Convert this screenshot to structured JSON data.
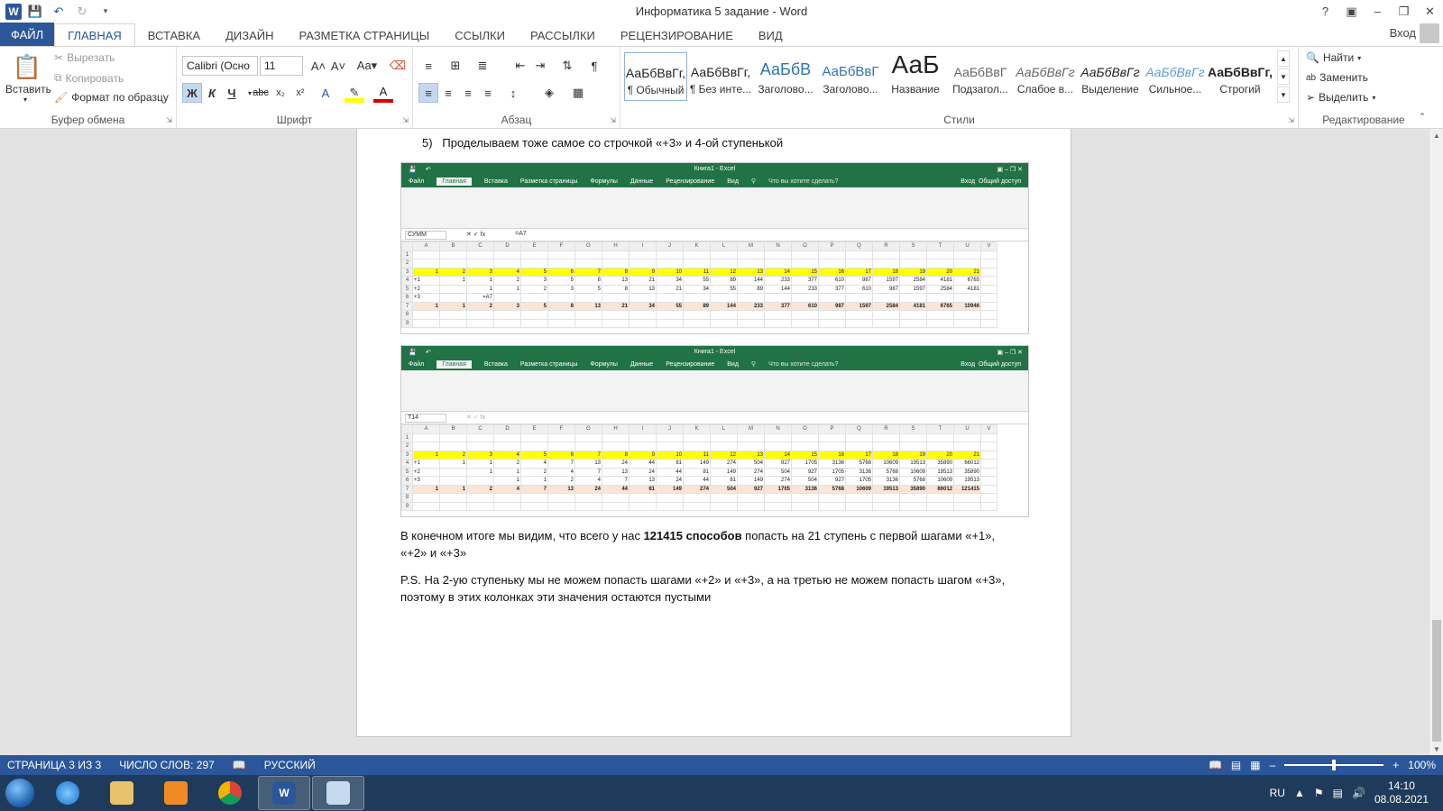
{
  "window": {
    "title": "Информатика 5 задание - Word",
    "help": "?",
    "login": "Вход"
  },
  "tabs": [
    "ФАЙЛ",
    "ГЛАВНАЯ",
    "ВСТАВКА",
    "ДИЗАЙН",
    "РАЗМЕТКА СТРАНИЦЫ",
    "ССЫЛКИ",
    "РАССЫЛКИ",
    "РЕЦЕНЗИРОВАНИЕ",
    "ВИД"
  ],
  "ribbon": {
    "clipboard": {
      "label": "Буфер обмена",
      "paste": "Вставить",
      "cut": "Вырезать",
      "copy": "Копировать",
      "format_painter": "Формат по образцу"
    },
    "font": {
      "label": "Шрифт",
      "name": "Calibri (Осно",
      "size": "11",
      "bold": "Ж",
      "italic": "К",
      "underline": "Ч"
    },
    "paragraph": {
      "label": "Абзац"
    },
    "styles": {
      "label": "Стили",
      "items": [
        {
          "preview": "АаБбВвГг,",
          "name": "¶ Обычный"
        },
        {
          "preview": "АаБбВвГг,",
          "name": "¶ Без инте..."
        },
        {
          "preview": "АаБбВ",
          "name": "Заголово..."
        },
        {
          "preview": "АаБбВвГ",
          "name": "Заголово..."
        },
        {
          "preview": "АаБ",
          "name": "Название"
        },
        {
          "preview": "АаБбВвГ",
          "name": "Подзагол..."
        },
        {
          "preview": "АаБбВвГг",
          "name": "Слабое в..."
        },
        {
          "preview": "АаБбВвГг",
          "name": "Выделение"
        },
        {
          "preview": "АаБбВвГг",
          "name": "Сильное..."
        },
        {
          "preview": "АаБбВвГг,",
          "name": "Строгий"
        }
      ]
    },
    "editing": {
      "label": "Редактирование",
      "find": "Найти",
      "replace": "Заменить",
      "select": "Выделить"
    }
  },
  "document": {
    "item_number": "5)",
    "item_text": "Проделываем тоже самое со строчкой «+3» и 4-ой ступенькой",
    "conclusion_pre": "В конечном итоге мы видим, что всего у нас ",
    "conclusion_bold": "121415 способов",
    "conclusion_post": " попасть на 21 ступень с первой шагами «+1», «+2» и «+3»",
    "ps": "P.S. На 2-ую ступеньку мы не можем попасть шагами «+2» и «+3», а на третью не можем попасть шагом «+3», поэтому в этих колонках эти значения остаются пустыми"
  },
  "excel": {
    "title": "Книга1 - Excel",
    "tabs": [
      "Файл",
      "Главная",
      "Вставка",
      "Разметка страницы",
      "Формулы",
      "Данные",
      "Рецензирование",
      "Вид"
    ],
    "tell_me": "Что вы хотите сделать?",
    "share": "Общий доступ",
    "login": "Вход",
    "columns": [
      "A",
      "B",
      "C",
      "D",
      "E",
      "F",
      "G",
      "H",
      "I",
      "J",
      "K",
      "L",
      "M",
      "N",
      "O",
      "P",
      "Q",
      "R",
      "S",
      "T",
      "U",
      "V"
    ],
    "shot1": {
      "name_box": "СУММ",
      "formula": "=A7",
      "header": [
        "1",
        "2",
        "3",
        "4",
        "5",
        "6",
        "7",
        "8",
        "9",
        "10",
        "11",
        "12",
        "13",
        "14",
        "15",
        "16",
        "17",
        "18",
        "19",
        "20",
        "21"
      ],
      "rows": [
        {
          "label": "+1",
          "values": [
            "",
            "1",
            "1",
            "2",
            "3",
            "5",
            "8",
            "13",
            "21",
            "34",
            "55",
            "89",
            "144",
            "233",
            "377",
            "610",
            "987",
            "1597",
            "2584",
            "4181",
            "6765"
          ]
        },
        {
          "label": "+2",
          "values": [
            "",
            "",
            "1",
            "1",
            "2",
            "3",
            "5",
            "8",
            "13",
            "21",
            "34",
            "55",
            "89",
            "144",
            "233",
            "377",
            "610",
            "987",
            "1597",
            "2584",
            "4181"
          ]
        },
        {
          "label": "+3",
          "values": [
            "",
            "",
            "=A7",
            "",
            "",
            "",
            "",
            "",
            "",
            "",
            "",
            "",
            "",
            "",
            "",
            "",
            "",
            "",
            "",
            "",
            ""
          ]
        }
      ],
      "total": [
        "1",
        "1",
        "2",
        "3",
        "5",
        "8",
        "13",
        "21",
        "34",
        "55",
        "89",
        "144",
        "233",
        "377",
        "610",
        "987",
        "1597",
        "2584",
        "4181",
        "6765",
        "10946"
      ]
    },
    "shot2": {
      "name_box": "T14",
      "formula": "",
      "header": [
        "1",
        "2",
        "3",
        "4",
        "5",
        "6",
        "7",
        "8",
        "9",
        "10",
        "11",
        "12",
        "13",
        "14",
        "15",
        "16",
        "17",
        "18",
        "19",
        "20",
        "21"
      ],
      "rows": [
        {
          "label": "+1",
          "values": [
            "",
            "1",
            "1",
            "2",
            "4",
            "7",
            "13",
            "24",
            "44",
            "81",
            "149",
            "274",
            "504",
            "927",
            "1705",
            "3136",
            "5768",
            "10609",
            "19513",
            "35890",
            "66012"
          ]
        },
        {
          "label": "+2",
          "values": [
            "",
            "",
            "1",
            "1",
            "2",
            "4",
            "7",
            "13",
            "24",
            "44",
            "81",
            "149",
            "274",
            "504",
            "927",
            "1705",
            "3136",
            "5768",
            "10609",
            "19513",
            "35890"
          ]
        },
        {
          "label": "+3",
          "values": [
            "",
            "",
            "",
            "1",
            "1",
            "2",
            "4",
            "7",
            "13",
            "24",
            "44",
            "81",
            "149",
            "274",
            "504",
            "927",
            "1705",
            "3136",
            "5768",
            "10609",
            "19513"
          ]
        }
      ],
      "total": [
        "1",
        "1",
        "2",
        "4",
        "7",
        "13",
        "24",
        "44",
        "81",
        "149",
        "274",
        "504",
        "927",
        "1705",
        "3136",
        "5768",
        "10609",
        "19513",
        "35890",
        "66012",
        "121415"
      ]
    }
  },
  "status": {
    "page": "СТРАНИЦА 3 ИЗ 3",
    "words": "ЧИСЛО СЛОВ: 297",
    "language": "РУССКИЙ",
    "zoom": "100%",
    "zoom_fraction": 0.5
  },
  "taskbar": {
    "lang": "RU",
    "time": "14:10",
    "date": "08.08.2021",
    "apps": [
      "ie-icon",
      "explorer-icon",
      "media-player-icon",
      "chrome-icon",
      "word-icon",
      "paint-icon"
    ]
  },
  "colors": {
    "word_blue": "#2b579a",
    "excel_green": "#217346",
    "highlight_yellow": "#ffff00",
    "total_row": "#fbe5d6"
  }
}
